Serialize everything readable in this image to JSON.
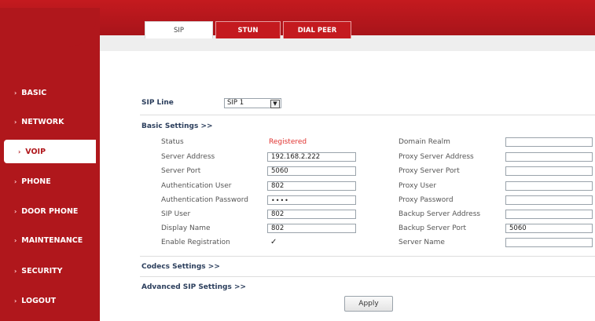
{
  "tabs": [
    {
      "label": "SIP"
    },
    {
      "label": "STUN"
    },
    {
      "label": "DIAL PEER"
    }
  ],
  "sidebar": {
    "items": [
      {
        "label": "BASIC"
      },
      {
        "label": "NETWORK"
      },
      {
        "label": "VOIP"
      },
      {
        "label": "PHONE"
      },
      {
        "label": "DOOR PHONE"
      },
      {
        "label": "MAINTENANCE"
      },
      {
        "label": "SECURITY"
      },
      {
        "label": "LOGOUT"
      }
    ]
  },
  "sip_line": {
    "label": "SIP Line",
    "value": "SIP 1"
  },
  "basic_settings": {
    "header": "Basic Settings >>",
    "left": [
      {
        "label": "Status",
        "value": "Registered"
      },
      {
        "label": "Server Address",
        "value": "192.168.2.222"
      },
      {
        "label": "Server Port",
        "value": "5060"
      },
      {
        "label": "Authentication User",
        "value": "802"
      },
      {
        "label": "Authentication Password",
        "value": "••••"
      },
      {
        "label": "SIP User",
        "value": "802"
      },
      {
        "label": "Display Name",
        "value": "802"
      },
      {
        "label": "Enable Registration",
        "value": "✓"
      }
    ],
    "right": [
      {
        "label": "Domain Realm",
        "value": ""
      },
      {
        "label": "Proxy Server Address",
        "value": ""
      },
      {
        "label": "Proxy Server Port",
        "value": ""
      },
      {
        "label": "Proxy User",
        "value": ""
      },
      {
        "label": "Proxy Password",
        "value": ""
      },
      {
        "label": "Backup Server Address",
        "value": ""
      },
      {
        "label": "Backup Server Port",
        "value": "5060"
      },
      {
        "label": "Server Name",
        "value": ""
      }
    ]
  },
  "codecs_settings": {
    "header": "Codecs Settings >>"
  },
  "advanced_sip_settings": {
    "header": "Advanced SIP Settings >>"
  },
  "apply_button": {
    "label": "Apply"
  },
  "colors": {
    "brand_red": "#b0171c",
    "status_registered": "#e0322f"
  }
}
